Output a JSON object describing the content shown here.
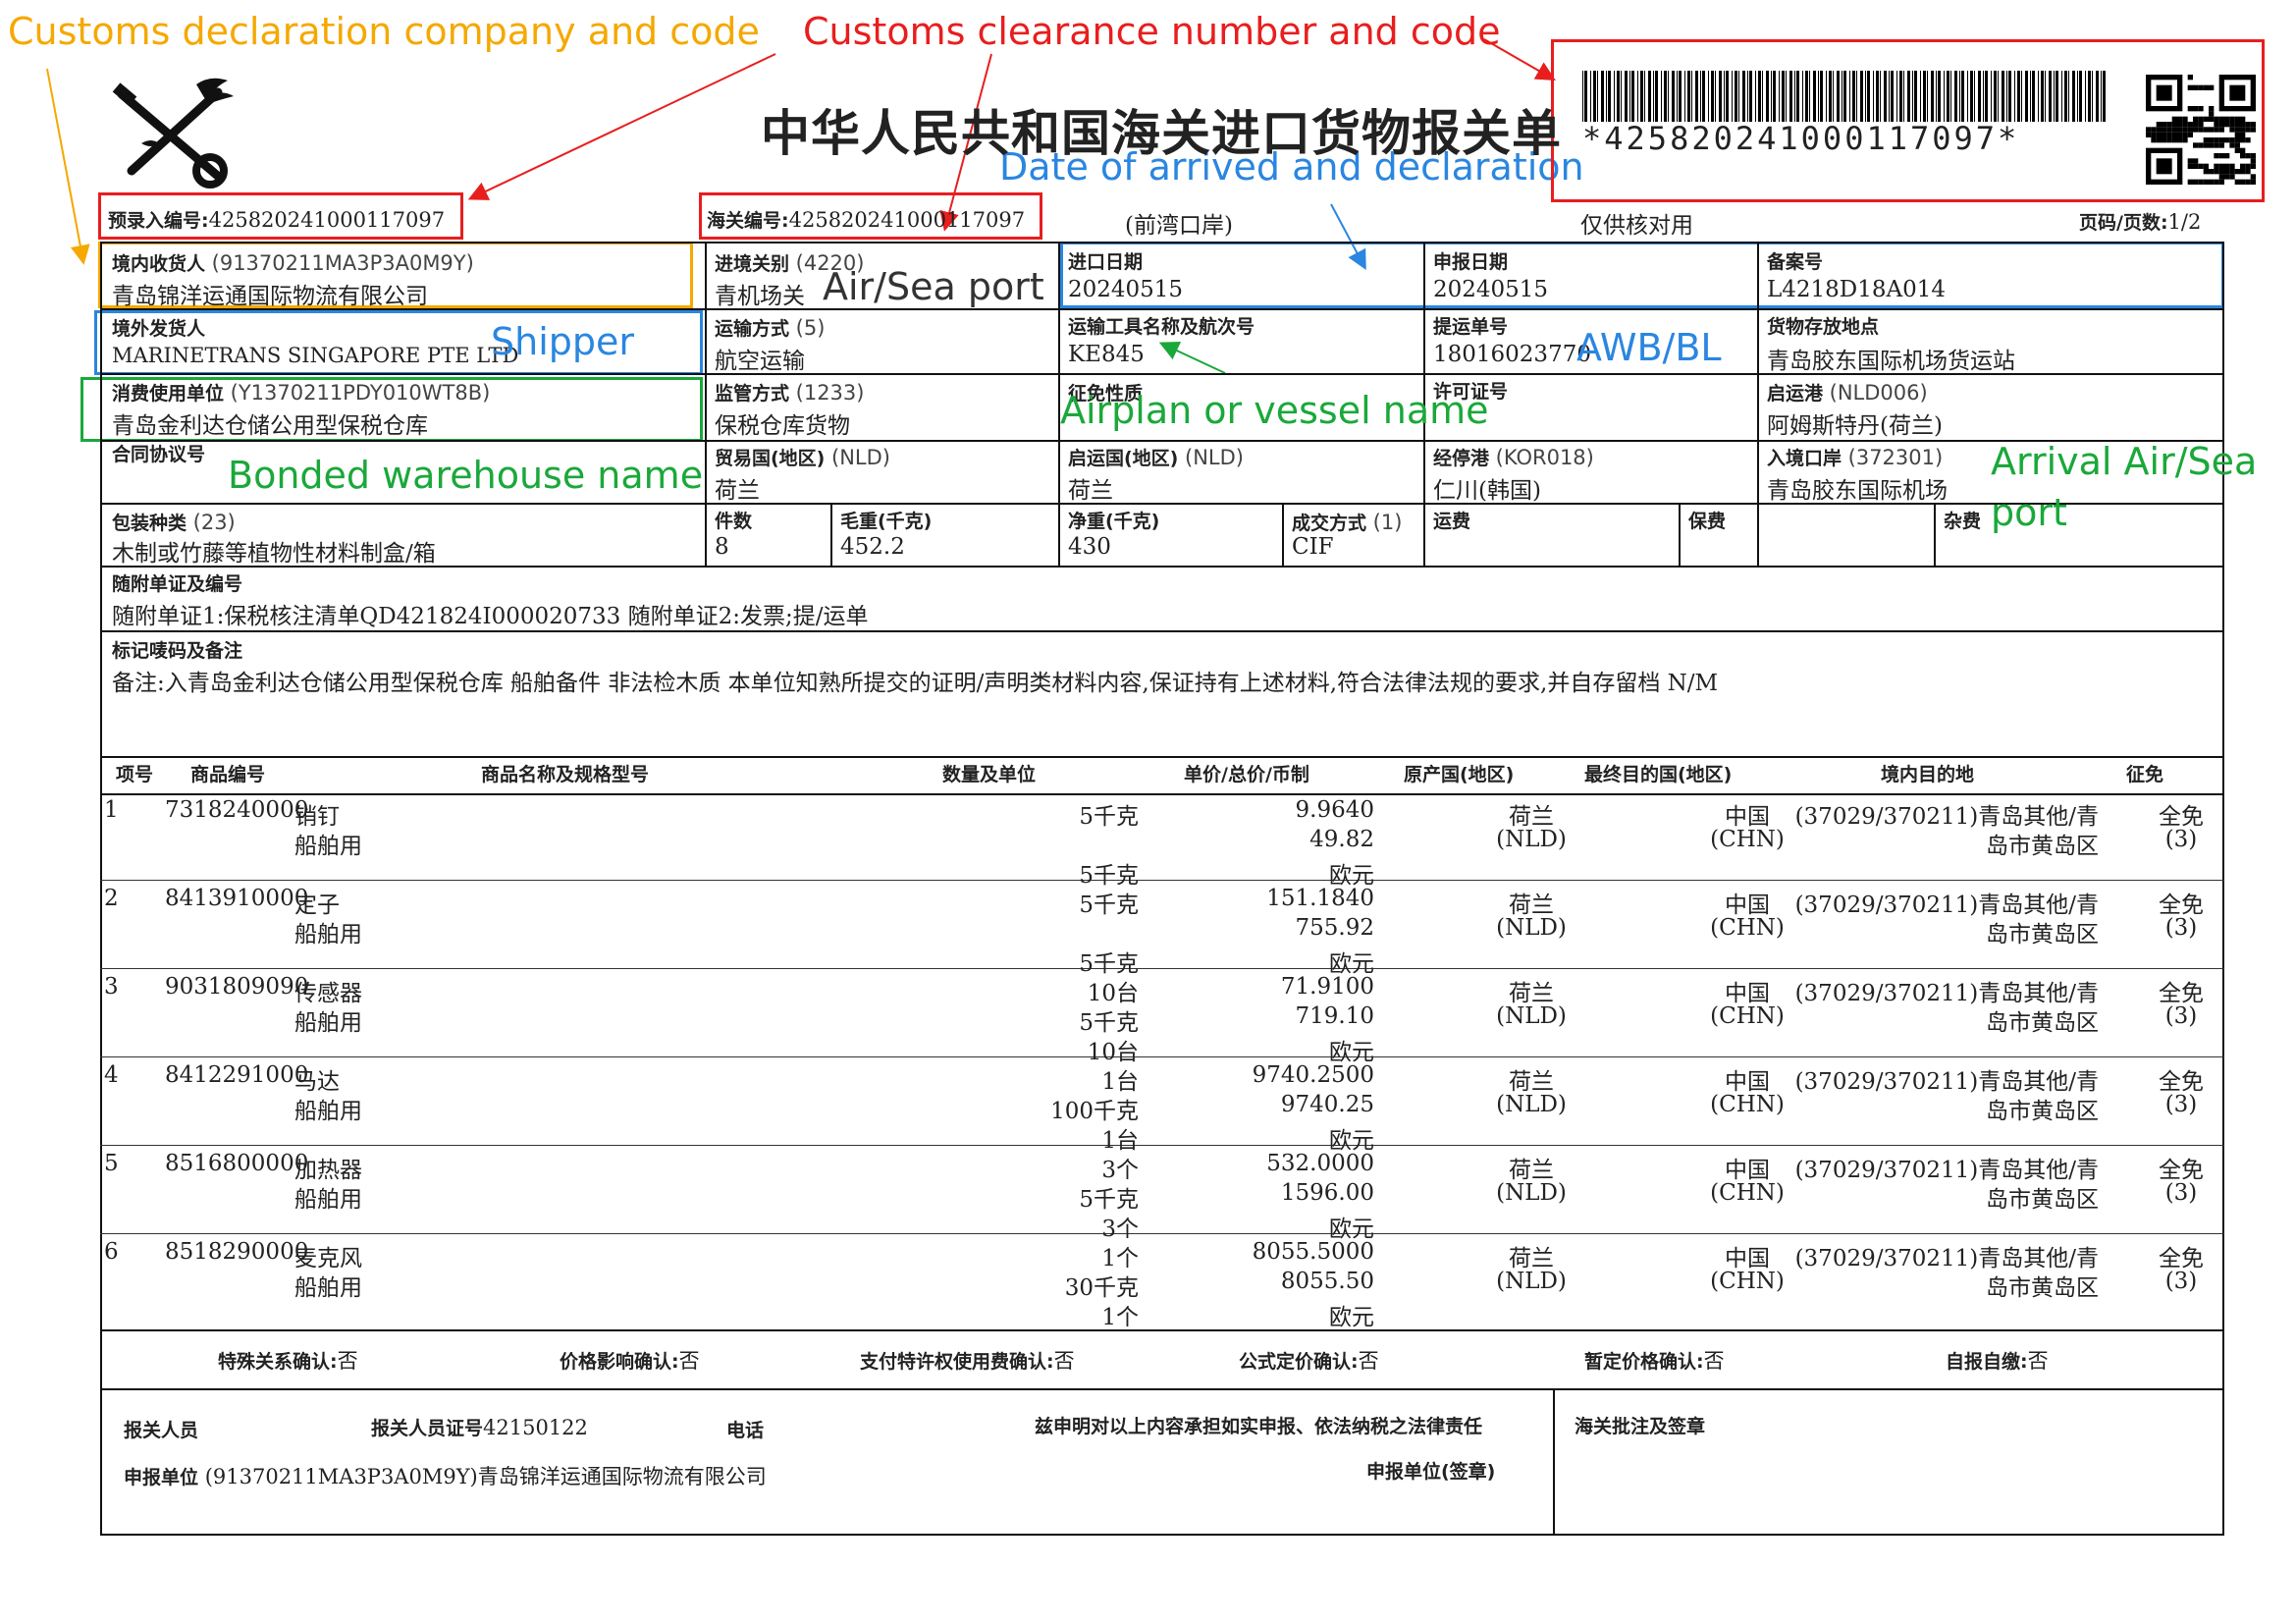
{
  "annotations": {
    "declaration_company": "Customs declaration company and code",
    "clearance_number": "Customs clearance number and code",
    "date_arrived": "Date of arrived and declaration",
    "air_sea_port": "Air/Sea port",
    "shipper": "Shipper",
    "awb_bl": "AWB/BL",
    "vessel_name": "Airplan or vessel name",
    "bonded_warehouse": "Bonded warehouse name",
    "arrival_port_1": "Arrival Air/Sea",
    "arrival_port_2": "port"
  },
  "header": {
    "title": "中华人民共和国海关进口货物报关单",
    "barcode_text": "*425820241000117097*",
    "pre_entry_label": "预录入编号:",
    "pre_entry_no": "425820241000117097",
    "customs_label": "海关编号:",
    "customs_no": "425820241000117097",
    "port_note": "(前湾口岸)",
    "verify_note": "仅供核对用",
    "page_label": "页码/页数:",
    "page_value": "1/2"
  },
  "fields": {
    "consignee_label": "境内收货人",
    "consignee_code": "(91370211MA3P3A0M9Y)",
    "consignee_name": "青岛锦洋运通国际物流有限公司",
    "entry_customs_label": "进境关别",
    "entry_customs_code": "(4220)",
    "entry_customs_name": "青机场关",
    "import_date_label": "进口日期",
    "import_date": "20240515",
    "declare_date_label": "申报日期",
    "declare_date": "20240515",
    "record_no_label": "备案号",
    "record_no": "L4218D18A014",
    "shipper_label": "境外发货人",
    "shipper_name": "MARINETRANS SINGAPORE PTE LTD",
    "transport_mode_label": "运输方式",
    "transport_mode_code": "(5)",
    "transport_mode": "航空运输",
    "vehicle_label": "运输工具名称及航次号",
    "vehicle": "KE845",
    "bl_label": "提运单号",
    "bl_no": "18016023770",
    "storage_label": "货物存放地点",
    "storage": "青岛胶东国际机场货运站",
    "user_label": "消费使用单位",
    "user_code": "(Y1370211PDY010WT8B)",
    "user_name": "青岛金利达仓储公用型保税仓库",
    "supervision_label": "监管方式",
    "supervision_code": "(1233)",
    "supervision": "保税仓库货物",
    "exemption_label": "征免性质",
    "license_label": "许可证号",
    "depart_port_label": "启运港",
    "depart_port_code": "(NLD006)",
    "depart_port": "阿姆斯特丹(荷兰)",
    "contract_label": "合同协议号",
    "trade_country_label": "贸易国(地区)",
    "trade_country_code": "(NLD)",
    "trade_country": "荷兰",
    "depart_country_label": "启运国(地区)",
    "depart_country_code": "(NLD)",
    "depart_country": "荷兰",
    "transit_port_label": "经停港",
    "transit_port_code": "(KOR018)",
    "transit_port": "仁川(韩国)",
    "entry_port_label": "入境口岸",
    "entry_port_code": "(372301)",
    "entry_port": "青岛胶东国际机场",
    "package_label": "包装种类",
    "package_code": "(23)",
    "package": "木制或竹藤等植物性材料制盒/箱",
    "pieces_label": "件数",
    "pieces": "8",
    "gross_label": "毛重(千克)",
    "gross": "452.2",
    "net_label": "净重(千克)",
    "net": "430",
    "terms_label": "成交方式",
    "terms_code": "(1)",
    "terms": "CIF",
    "freight_label": "运费",
    "insurance_label": "保费",
    "misc_label": "杂费",
    "docs_label": "随附单证及编号",
    "docs": "随附单证1:保税核注清单QD421824I000020733 随附单证2:发票;提/运单",
    "remarks_label": "标记唛码及备注",
    "remarks": "备注:入青岛金利达仓储公用型保税仓库 船舶备件 非法检木质 本单位知熟所提交的证明/声明类材料内容,保证持有上述材料,符合法律法规的要求,并自存留档 N/M"
  },
  "item_headers": [
    "项号",
    "商品编号",
    "商品名称及规格型号",
    "数量及单位",
    "单价/总价/币制",
    "原产国(地区)",
    "最终目的国(地区)",
    "境内目的地",
    "征免"
  ],
  "items": [
    {
      "no": "1",
      "code": "7318240000",
      "name": "销钉",
      "spec": "船舶用",
      "q1": "5千克",
      "q2": "",
      "q3": "5千克",
      "unit_price": "9.9640",
      "total": "49.82",
      "currency": "欧元",
      "origin": "荷兰",
      "origin_code": "(NLD)",
      "dest": "中国",
      "dest_code": "(CHN)",
      "domestic1": "(37029/370211)青岛其他/青",
      "domestic2": "岛市黄岛区",
      "tax1": "全免",
      "tax2": "(3)"
    },
    {
      "no": "2",
      "code": "8413910000",
      "name": "定子",
      "spec": "船舶用",
      "q1": "5千克",
      "q2": "",
      "q3": "5千克",
      "unit_price": "151.1840",
      "total": "755.92",
      "currency": "欧元",
      "origin": "荷兰",
      "origin_code": "(NLD)",
      "dest": "中国",
      "dest_code": "(CHN)",
      "domestic1": "(37029/370211)青岛其他/青",
      "domestic2": "岛市黄岛区",
      "tax1": "全免",
      "tax2": "(3)"
    },
    {
      "no": "3",
      "code": "9031809090",
      "name": "传感器",
      "spec": "船舶用",
      "q1": "10台",
      "q2": "5千克",
      "q3": "10台",
      "unit_price": "71.9100",
      "total": "719.10",
      "currency": "欧元",
      "origin": "荷兰",
      "origin_code": "(NLD)",
      "dest": "中国",
      "dest_code": "(CHN)",
      "domestic1": "(37029/370211)青岛其他/青",
      "domestic2": "岛市黄岛区",
      "tax1": "全免",
      "tax2": "(3)"
    },
    {
      "no": "4",
      "code": "8412291000",
      "name": "马达",
      "spec": "船舶用",
      "q1": "1台",
      "q2": "100千克",
      "q3": "1台",
      "unit_price": "9740.2500",
      "total": "9740.25",
      "currency": "欧元",
      "origin": "荷兰",
      "origin_code": "(NLD)",
      "dest": "中国",
      "dest_code": "(CHN)",
      "domestic1": "(37029/370211)青岛其他/青",
      "domestic2": "岛市黄岛区",
      "tax1": "全免",
      "tax2": "(3)"
    },
    {
      "no": "5",
      "code": "8516800000",
      "name": "加热器",
      "spec": "船舶用",
      "q1": "3个",
      "q2": "5千克",
      "q3": "3个",
      "unit_price": "532.0000",
      "total": "1596.00",
      "currency": "欧元",
      "origin": "荷兰",
      "origin_code": "(NLD)",
      "dest": "中国",
      "dest_code": "(CHN)",
      "domestic1": "(37029/370211)青岛其他/青",
      "domestic2": "岛市黄岛区",
      "tax1": "全免",
      "tax2": "(3)"
    },
    {
      "no": "6",
      "code": "8518290000",
      "name": "麦克风",
      "spec": "船舶用",
      "q1": "1个",
      "q2": "30千克",
      "q3": "1个",
      "unit_price": "8055.5000",
      "total": "8055.50",
      "currency": "欧元",
      "origin": "荷兰",
      "origin_code": "(NLD)",
      "dest": "中国",
      "dest_code": "(CHN)",
      "domestic1": "(37029/370211)青岛其他/青",
      "domestic2": "岛市黄岛区",
      "tax1": "全免",
      "tax2": "(3)"
    }
  ],
  "confirms": {
    "special_label": "特殊关系确认:",
    "special": "否",
    "price_label": "价格影响确认:",
    "price": "否",
    "royalty_label": "支付特许权使用费确认:",
    "royalty": "否",
    "formula_label": "公式定价确认:",
    "formula": "否",
    "provisional_label": "暂定价格确认:",
    "provisional": "否",
    "self_label": "自报自缴:",
    "self": "否"
  },
  "footer": {
    "declarant_label": "报关人员",
    "declarant_id_label": "报关人员证号",
    "declarant_id": "42150122",
    "phone_label": "电话",
    "statement": "兹申明对以上内容承担如实申报、依法纳税之法律责任",
    "unit_label": "申报单位",
    "unit": "(91370211MA3P3A0M9Y)青岛锦洋运通国际物流有限公司",
    "seal_label": "申报单位(签章)",
    "approval_label": "海关批注及签章"
  }
}
